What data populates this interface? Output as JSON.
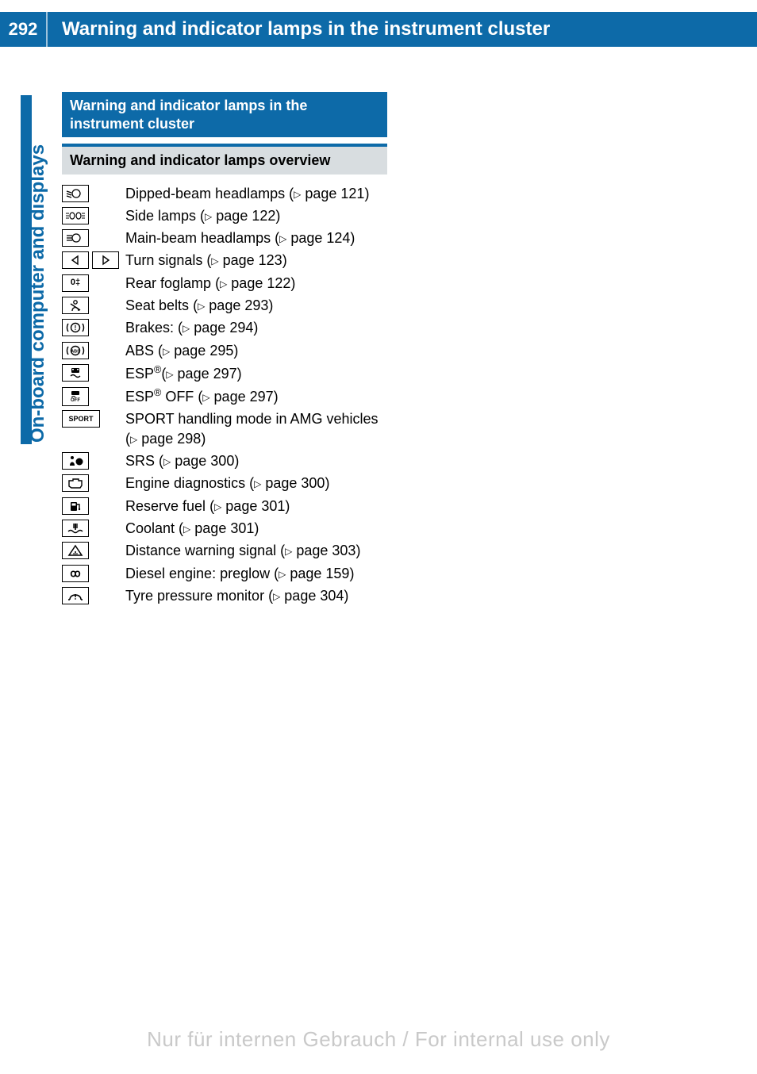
{
  "header": {
    "page_number": "292",
    "title": "Warning and indicator lamps in the instrument cluster"
  },
  "side_tab": "On-board computer and displays",
  "section_title": "Warning and indicator lamps in the instrument cluster",
  "subsection_title": "Warning and indicator lamps overview",
  "lamps": [
    {
      "icon": "dipped-beam",
      "label": "Dipped-beam headlamps",
      "page": "121"
    },
    {
      "icon": "side-lamps",
      "label": "Side lamps",
      "page": "122"
    },
    {
      "icon": "main-beam",
      "label": "Main-beam headlamps",
      "page": "124"
    },
    {
      "icon": "turn-signals",
      "label": "Turn signals",
      "page": "123"
    },
    {
      "icon": "rear-fog",
      "label": "Rear foglamp",
      "page": "122"
    },
    {
      "icon": "seat-belts",
      "label": "Seat belts",
      "page": "293"
    },
    {
      "icon": "brakes",
      "label": "Brakes:",
      "page": "294"
    },
    {
      "icon": "abs",
      "label": "ABS",
      "page": "295"
    },
    {
      "icon": "esp",
      "label_html": "ESP<sup>®</sup>",
      "page": "297",
      "nospace": true
    },
    {
      "icon": "esp-off",
      "label_html": "ESP<sup>®</sup> OFF",
      "page": "297"
    },
    {
      "icon": "sport",
      "label": "SPORT handling mode in AMG vehicles",
      "page": "298"
    },
    {
      "icon": "srs",
      "label": "SRS",
      "page": "300"
    },
    {
      "icon": "engine",
      "label": "Engine diagnostics",
      "page": "300"
    },
    {
      "icon": "reserve-fuel",
      "label": "Reserve fuel",
      "page": "301"
    },
    {
      "icon": "coolant",
      "label": "Coolant",
      "page": "301"
    },
    {
      "icon": "distance",
      "label": "Distance warning signal",
      "page": "303"
    },
    {
      "icon": "preglow",
      "label": "Diesel engine: preglow",
      "page": "159"
    },
    {
      "icon": "tyre",
      "label": "Tyre pressure monitor",
      "page": "304"
    }
  ],
  "watermark": "Nur für internen Gebrauch / For internal use only",
  "page_word": "page",
  "icon_text": {
    "rear-fog": "0‡",
    "sport": "SPORT",
    "preglow": "ꝏ",
    "esp-off": "OFF"
  }
}
